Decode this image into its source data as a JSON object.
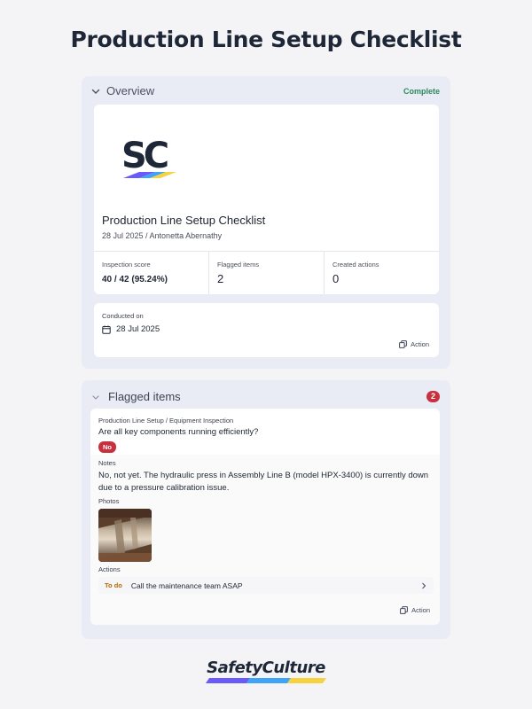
{
  "page": {
    "title": "Production Line Setup Checklist"
  },
  "overview": {
    "section_title": "Overview",
    "status": "Complete",
    "logo_icon": "sc-logo",
    "report_title": "Production Line Setup Checklist",
    "report_subtitle": "28 Jul 2025 / Antonetta Abernathy",
    "stats": [
      {
        "label": "Inspection score",
        "value": "40 / 42 (95.24%)"
      },
      {
        "label": "Flagged items",
        "value": "2"
      },
      {
        "label": "Created actions",
        "value": "0"
      }
    ],
    "conducted_label": "Conducted on",
    "conducted_date": "28 Jul 2025",
    "action_label": "Action"
  },
  "flagged": {
    "section_title": "Flagged items",
    "count": "2",
    "item": {
      "breadcrumb": "Production Line Setup / Equipment Inspection",
      "question": "Are all key components running efficiently?",
      "answer": "No",
      "notes_label": "Notes",
      "notes": "No, not yet. The hydraulic press in Assembly Line B (model HPX-3400) is currently down due to a pressure calibration issue.",
      "photos_label": "Photos",
      "actions_label": "Actions",
      "todo_status": "To do",
      "todo_text": "Call the maintenance team ASAP"
    },
    "action_label": "Action"
  },
  "footer": {
    "brand": "SafetyCulture"
  },
  "colors": {
    "accent_green": "#2c8a5d",
    "flag_red": "#c9303d",
    "todo_orange": "#b86a00",
    "section_bg": "#e9ebf5"
  }
}
